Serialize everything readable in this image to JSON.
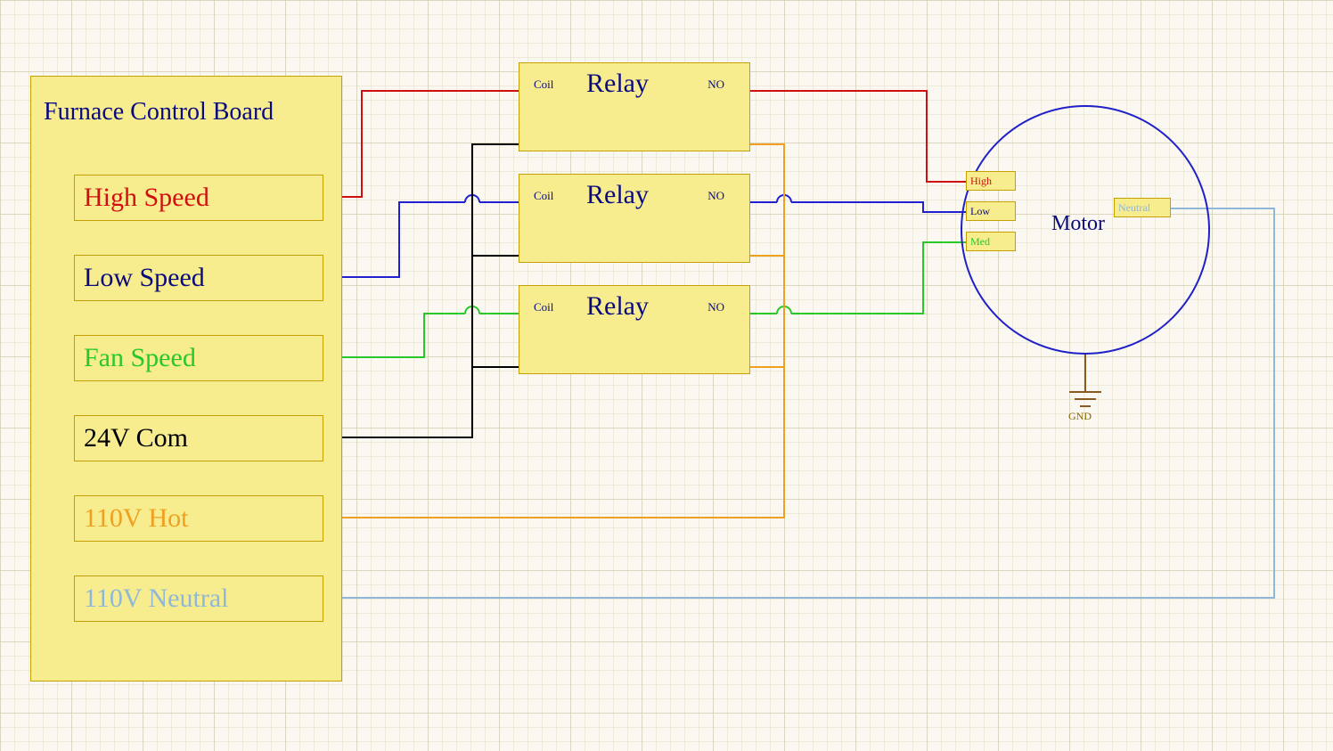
{
  "fcb": {
    "title": "Furnace Control Board",
    "terminals": {
      "high": "High Speed",
      "low": "Low Speed",
      "fan": "Fan Speed",
      "com24": "24V Com",
      "hot110": "110V Hot",
      "neu110": "110V Neutral"
    }
  },
  "relay": {
    "title": "Relay",
    "coil": "Coil",
    "no": "NO"
  },
  "motor": {
    "label": "Motor",
    "terminals": {
      "high": "High",
      "low": "Low",
      "med": "Med",
      "neutral": "Neutral"
    },
    "gnd": "GND"
  },
  "colors": {
    "red": "#d01010",
    "blue": "#2020d0",
    "navy": "#0a0a80",
    "green": "#28c828",
    "black": "#000000",
    "orange": "#f0a020",
    "lightblue": "#8fb8d8",
    "brown": "#8a5a20"
  }
}
